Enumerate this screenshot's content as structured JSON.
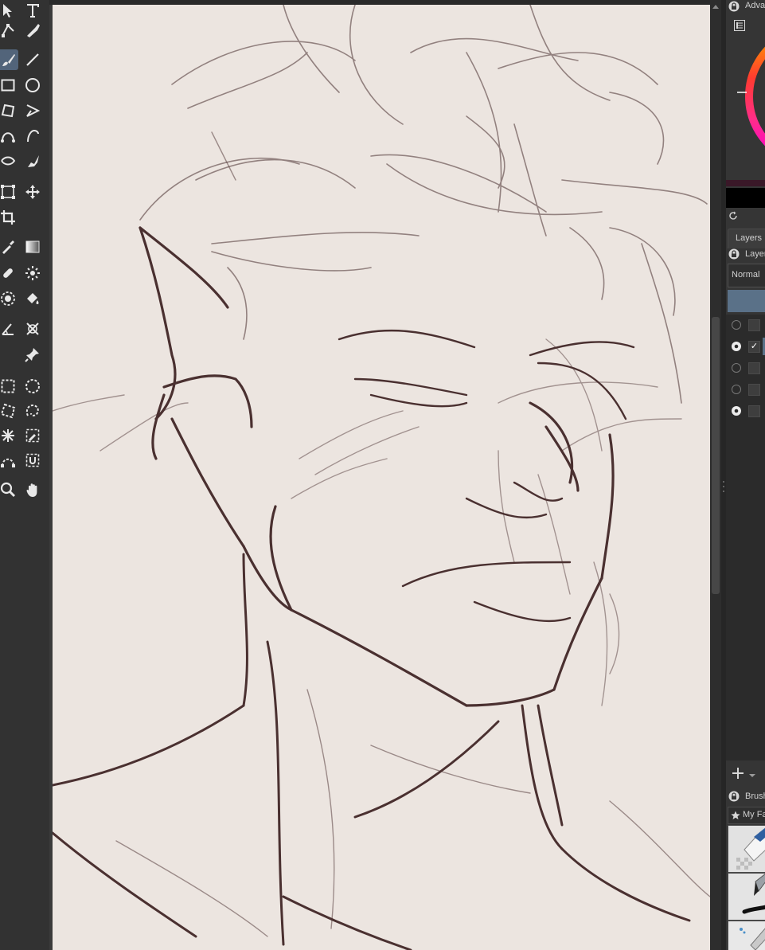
{
  "toolbox": {
    "tools": [
      {
        "name": "select-shapes-tool-icon"
      },
      {
        "name": "text-tool-icon"
      },
      {
        "name": "edit-shapes-tool-icon"
      },
      {
        "name": "calligraphy-tool-icon"
      },
      {
        "name": "freehand-brush-tool-icon",
        "active": true
      },
      {
        "name": "line-tool-icon"
      },
      {
        "name": "rectangle-tool-icon"
      },
      {
        "name": "ellipse-tool-icon"
      },
      {
        "name": "polygon-tool-icon"
      },
      {
        "name": "polyline-tool-icon"
      },
      {
        "name": "bezier-curve-tool-icon"
      },
      {
        "name": "freehand-path-tool-icon"
      },
      {
        "name": "dynamic-brush-tool-icon"
      },
      {
        "name": "multibrush-tool-icon"
      },
      {
        "name": "transform-tool-icon"
      },
      {
        "name": "move-tool-icon"
      },
      {
        "name": "crop-tool-icon"
      },
      {
        "name": "gradient-tool-icon"
      },
      {
        "name": "color-sampler-tool-icon"
      },
      {
        "name": "colorize-mask-tool-icon"
      },
      {
        "name": "smart-patch-tool-icon"
      },
      {
        "name": "fill-tool-icon"
      },
      {
        "name": "enclose-and-fill-tool-icon"
      },
      {
        "name": "assistant-tool-icon"
      },
      {
        "name": "measure-tool-icon"
      },
      {
        "name": "reference-images-tool-icon"
      },
      {
        "name": "rectangular-selection-tool-icon"
      },
      {
        "name": "elliptical-selection-tool-icon"
      },
      {
        "name": "polygonal-selection-tool-icon"
      },
      {
        "name": "freehand-selection-tool-icon"
      },
      {
        "name": "contiguous-selection-tool-icon"
      },
      {
        "name": "similar-color-selection-tool-icon"
      },
      {
        "name": "bezier-selection-tool-icon"
      },
      {
        "name": "magnetic-selection-tool-icon"
      },
      {
        "name": "zoom-tool-icon"
      },
      {
        "name": "pan-tool-icon"
      }
    ]
  },
  "color_docker": {
    "title": "Adva",
    "wheel_colors": [
      "#ff3b30",
      "#ff9500",
      "#ff2d8a",
      "#ff00cc"
    ],
    "foreground_color": "#3a1828",
    "background_color": "#000000"
  },
  "layers_docker": {
    "tab_label": "Layers",
    "title": "Layer",
    "blend_mode": "Normal",
    "accent_color": "#5a7188",
    "layers": [
      {
        "visible": false,
        "checked": false,
        "selected": false
      },
      {
        "visible": true,
        "checked": true,
        "selected": true
      },
      {
        "visible": false,
        "checked": false,
        "selected": false
      },
      {
        "visible": false,
        "checked": false,
        "selected": false
      },
      {
        "visible": true,
        "checked": false,
        "selected": false
      }
    ]
  },
  "brush_docker": {
    "title": "Brush",
    "favorites_label": "My Fa",
    "presets": [
      {
        "name": "eraser-preset"
      },
      {
        "name": "ink-pen-preset"
      },
      {
        "name": "airbrush-preset"
      }
    ]
  },
  "canvas": {
    "background_color": "#ece5e0",
    "stroke_color": "#4a3030"
  }
}
